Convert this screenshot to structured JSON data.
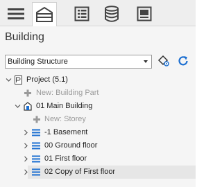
{
  "toolbar": {
    "buttons": [
      {
        "icon": "hamburger-menu-icon"
      },
      {
        "icon": "building-icon",
        "active": true
      },
      {
        "icon": "list-icon"
      },
      {
        "icon": "database-icon"
      },
      {
        "icon": "drawing-sheet-icon"
      }
    ]
  },
  "panel": {
    "title": "Building",
    "structure_select": {
      "value": "Building Structure"
    },
    "settings_icon": "gear-diamond-icon",
    "refresh_icon": "refresh-icon"
  },
  "tree": {
    "project": {
      "label": "Project (5.1)"
    },
    "new_building_part": {
      "label": "New: Building Part"
    },
    "building": {
      "label": "01 Main Building"
    },
    "new_storey": {
      "label": "New: Storey"
    },
    "storeys": [
      {
        "label": "-1 Basement"
      },
      {
        "label": "00 Ground floor"
      },
      {
        "label": "01 First floor"
      },
      {
        "label": "02 Copy of First floor",
        "selected": true
      }
    ]
  },
  "colors": {
    "accent": "#1c6fd1",
    "selection": "#e6e6e6",
    "muted_text": "#9a9a9a"
  }
}
